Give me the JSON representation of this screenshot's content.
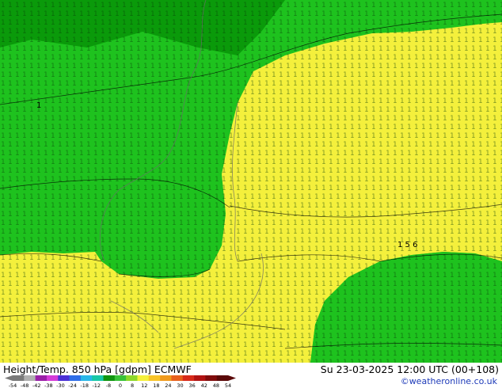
{
  "footer": {
    "title": "Height/Temp. 850 hPa [gdpm] ECMWF",
    "datetime": "Su 23-03-2025 12:00 UTC (00+108)",
    "credit": "©weatheronline.co.uk"
  },
  "legend": {
    "ticks": [
      "-54",
      "-48",
      "-42",
      "-38",
      "-30",
      "-24",
      "-18",
      "-12",
      "-8",
      "0",
      "8",
      "12",
      "18",
      "24",
      "30",
      "36",
      "42",
      "48",
      "54"
    ],
    "colors": [
      "#7a7a7a",
      "#b0b0b0",
      "#9a1fa8",
      "#d53bd8",
      "#4a2fd6",
      "#2f6ee8",
      "#29b7e8",
      "#18c8a8",
      "#109410",
      "#38c238",
      "#8ed82a",
      "#f4f03c",
      "#f8c428",
      "#f09a1c",
      "#e8601c",
      "#d82a1a",
      "#b01212",
      "#800c0c",
      "#5a0808"
    ]
  },
  "map": {
    "colors": {
      "green_dark": "#0a9a0a",
      "green": "#1ec21e",
      "green_light": "#3ad03a",
      "yellow": "#f4f03c",
      "yellow_light": "#f8f45a",
      "contour": "#000000",
      "border": "#8a8a8a"
    },
    "labels": [
      {
        "text": "1",
        "name": "label-low-1"
      },
      {
        "text": "1 5 6",
        "name": "label-156"
      }
    ]
  }
}
